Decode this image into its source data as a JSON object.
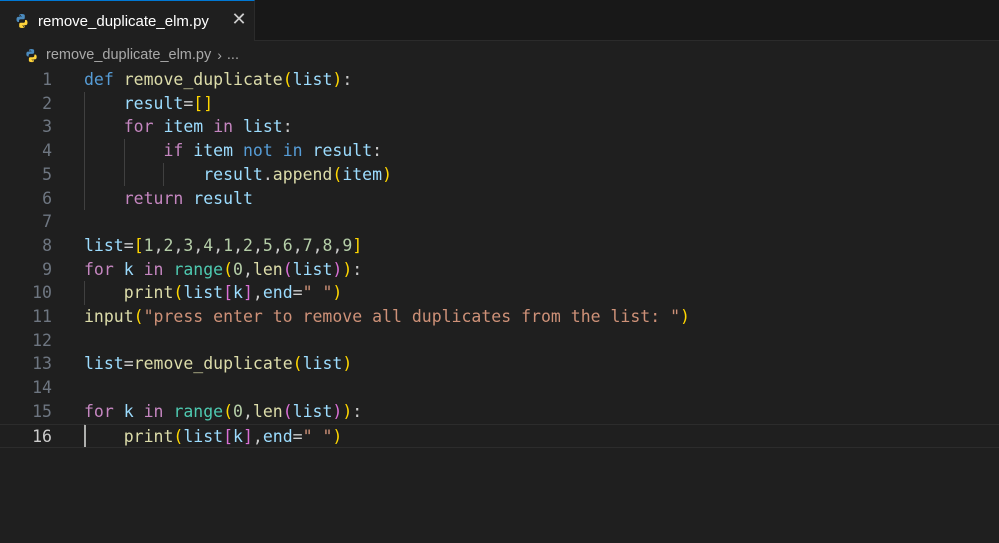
{
  "tab": {
    "label": "remove_duplicate_elm.py",
    "close_glyph": "✕"
  },
  "breadcrumb": {
    "file": "remove_duplicate_elm.py",
    "separator": "›",
    "rest": "..."
  },
  "editor": {
    "current_line": 16,
    "lines": [
      {
        "n": "1",
        "tokens": [
          [
            "kw",
            "def"
          ],
          [
            "pl",
            " "
          ],
          [
            "fn",
            "remove_duplicate"
          ],
          [
            "b1",
            "("
          ],
          [
            "var",
            "list"
          ],
          [
            "b1",
            ")"
          ],
          [
            "pl",
            ":"
          ]
        ]
      },
      {
        "n": "2",
        "tokens": [
          [
            "pl",
            "    "
          ],
          [
            "var",
            "result"
          ],
          [
            "pl",
            "="
          ],
          [
            "b1",
            "[]"
          ]
        ]
      },
      {
        "n": "3",
        "tokens": [
          [
            "pl",
            "    "
          ],
          [
            "ctl",
            "for"
          ],
          [
            "pl",
            " "
          ],
          [
            "var",
            "item"
          ],
          [
            "pl",
            " "
          ],
          [
            "ctl",
            "in"
          ],
          [
            "pl",
            " "
          ],
          [
            "var",
            "list"
          ],
          [
            "pl",
            ":"
          ]
        ]
      },
      {
        "n": "4",
        "tokens": [
          [
            "pl",
            "        "
          ],
          [
            "ctl",
            "if"
          ],
          [
            "pl",
            " "
          ],
          [
            "var",
            "item"
          ],
          [
            "pl",
            " "
          ],
          [
            "kw",
            "not"
          ],
          [
            "pl",
            " "
          ],
          [
            "kw",
            "in"
          ],
          [
            "pl",
            " "
          ],
          [
            "var",
            "result"
          ],
          [
            "pl",
            ":"
          ]
        ]
      },
      {
        "n": "5",
        "tokens": [
          [
            "pl",
            "            "
          ],
          [
            "var",
            "result"
          ],
          [
            "pl",
            "."
          ],
          [
            "fn",
            "append"
          ],
          [
            "b1",
            "("
          ],
          [
            "var",
            "item"
          ],
          [
            "b1",
            ")"
          ]
        ]
      },
      {
        "n": "6",
        "tokens": [
          [
            "pl",
            "    "
          ],
          [
            "ctl",
            "return"
          ],
          [
            "pl",
            " "
          ],
          [
            "var",
            "result"
          ]
        ]
      },
      {
        "n": "7",
        "tokens": []
      },
      {
        "n": "8",
        "tokens": [
          [
            "var",
            "list"
          ],
          [
            "pl",
            "="
          ],
          [
            "b1",
            "["
          ],
          [
            "num",
            "1"
          ],
          [
            "pl",
            ","
          ],
          [
            "num",
            "2"
          ],
          [
            "pl",
            ","
          ],
          [
            "num",
            "3"
          ],
          [
            "pl",
            ","
          ],
          [
            "num",
            "4"
          ],
          [
            "pl",
            ","
          ],
          [
            "num",
            "1"
          ],
          [
            "pl",
            ","
          ],
          [
            "num",
            "2"
          ],
          [
            "pl",
            ","
          ],
          [
            "num",
            "5"
          ],
          [
            "pl",
            ","
          ],
          [
            "num",
            "6"
          ],
          [
            "pl",
            ","
          ],
          [
            "num",
            "7"
          ],
          [
            "pl",
            ","
          ],
          [
            "num",
            "8"
          ],
          [
            "pl",
            ","
          ],
          [
            "num",
            "9"
          ],
          [
            "b1",
            "]"
          ]
        ]
      },
      {
        "n": "9",
        "tokens": [
          [
            "ctl",
            "for"
          ],
          [
            "pl",
            " "
          ],
          [
            "var",
            "k"
          ],
          [
            "pl",
            " "
          ],
          [
            "ctl",
            "in"
          ],
          [
            "pl",
            " "
          ],
          [
            "cls",
            "range"
          ],
          [
            "b1",
            "("
          ],
          [
            "num",
            "0"
          ],
          [
            "pl",
            ","
          ],
          [
            "fn",
            "len"
          ],
          [
            "b2",
            "("
          ],
          [
            "var",
            "list"
          ],
          [
            "b2",
            ")"
          ],
          [
            "b1",
            ")"
          ],
          [
            "pl",
            ":"
          ]
        ]
      },
      {
        "n": "10",
        "tokens": [
          [
            "pl",
            "    "
          ],
          [
            "fn",
            "print"
          ],
          [
            "b1",
            "("
          ],
          [
            "var",
            "list"
          ],
          [
            "b2",
            "["
          ],
          [
            "var",
            "k"
          ],
          [
            "b2",
            "]"
          ],
          [
            "pl",
            ","
          ],
          [
            "var",
            "end"
          ],
          [
            "pl",
            "="
          ],
          [
            "str",
            "\" \""
          ],
          [
            "b1",
            ")"
          ]
        ]
      },
      {
        "n": "11",
        "tokens": [
          [
            "fn",
            "input"
          ],
          [
            "b1",
            "("
          ],
          [
            "str",
            "\"press enter to remove all duplicates from the list: \""
          ],
          [
            "b1",
            ")"
          ]
        ]
      },
      {
        "n": "12",
        "tokens": []
      },
      {
        "n": "13",
        "tokens": [
          [
            "var",
            "list"
          ],
          [
            "pl",
            "="
          ],
          [
            "fn",
            "remove_duplicate"
          ],
          [
            "b1",
            "("
          ],
          [
            "var",
            "list"
          ],
          [
            "b1",
            ")"
          ]
        ]
      },
      {
        "n": "14",
        "tokens": []
      },
      {
        "n": "15",
        "tokens": [
          [
            "ctl",
            "for"
          ],
          [
            "pl",
            " "
          ],
          [
            "var",
            "k"
          ],
          [
            "pl",
            " "
          ],
          [
            "ctl",
            "in"
          ],
          [
            "pl",
            " "
          ],
          [
            "cls",
            "range"
          ],
          [
            "b1",
            "("
          ],
          [
            "num",
            "0"
          ],
          [
            "pl",
            ","
          ],
          [
            "fn",
            "len"
          ],
          [
            "b2",
            "("
          ],
          [
            "var",
            "list"
          ],
          [
            "b2",
            ")"
          ],
          [
            "b1",
            ")"
          ],
          [
            "pl",
            ":"
          ]
        ]
      },
      {
        "n": "16",
        "tokens": [
          [
            "pl",
            "    "
          ],
          [
            "fn",
            "print"
          ],
          [
            "b1",
            "("
          ],
          [
            "var",
            "list"
          ],
          [
            "b2",
            "["
          ],
          [
            "var",
            "k"
          ],
          [
            "b2",
            "]"
          ],
          [
            "pl",
            ","
          ],
          [
            "var",
            "end"
          ],
          [
            "pl",
            "="
          ],
          [
            "str",
            "\" \""
          ],
          [
            "b1",
            ")"
          ]
        ]
      }
    ]
  }
}
